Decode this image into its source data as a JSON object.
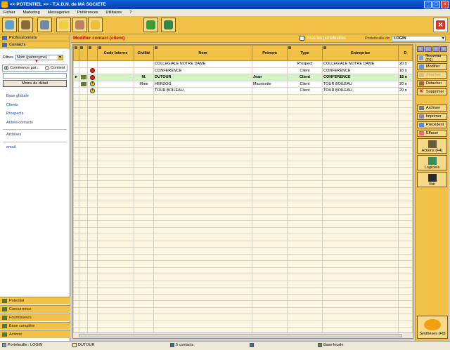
{
  "window": {
    "title": "<< POTENTIEL >> - T.A.D.N. de MA SOCIETE"
  },
  "menu": [
    "Fichier",
    "Marketing",
    "Messageries",
    "Préférences",
    "Utilitaires",
    "?"
  ],
  "left": {
    "professionnels": "Professionnels",
    "contacts": "Contacts",
    "filtres_label": "Filtres",
    "filtres_value": "Nom (patronyme)",
    "radio_commence": "Commence par...",
    "radio_contient": "Contient",
    "moins_detail": "Moins de détail",
    "links": [
      "Base globale",
      "Clients",
      "Prospects",
      "Autres contacts"
    ],
    "archives": "Archives",
    "email": "email",
    "bottom": [
      "Potentiel",
      "Concurrence",
      "Fournisseurs",
      "Base complète",
      "Actions"
    ]
  },
  "header": {
    "title": "Modifier contact (client)",
    "tous": "Tous les portefeuilles",
    "portefeuille_label": "Portefeuille de",
    "portefeuille_value": "LOGIN"
  },
  "grid": {
    "columns": [
      "Code Interne",
      "Civilité",
      "Nom",
      "Prénom",
      "Type",
      "Entreprise",
      "D"
    ],
    "rows": [
      {
        "civ": "",
        "nom": "COLLEGIALE NOTRE DAME",
        "prenom": "",
        "type": "Prospect",
        "entreprise": "COLLEGIALE NOTRE DAME",
        "d": "20 n",
        "icon": "none"
      },
      {
        "civ": "",
        "nom": "CONFERENCE",
        "prenom": "",
        "type": "Client",
        "entreprise": "CONFERENCE",
        "d": "18 n",
        "icon": "red"
      },
      {
        "civ": "M.",
        "nom": "DUTOUR",
        "prenom": "Jean",
        "type": "Client",
        "entreprise": "CONFERENCE",
        "d": "18 n",
        "icon": "red"
      },
      {
        "civ": "Mme",
        "nom": "HERZOG",
        "prenom": "Mauricette",
        "type": "Client",
        "entreprise": "TOUR BOILEAU",
        "d": "20 n",
        "icon": "yellow"
      },
      {
        "civ": "",
        "nom": "TOUR BOILEAU",
        "prenom": "",
        "type": "Client",
        "entreprise": "TOUR BOILEAU",
        "d": "20 n",
        "icon": "yellow"
      }
    ]
  },
  "right": {
    "nouveau": "Nouveau (F6)",
    "modifier": "Modifier",
    "attacher": "Attacher",
    "detacher": "Détacher",
    "supprimer": "Supprimer",
    "archiver": "Archiver",
    "imprimer": "Imprimer",
    "precedent": "Précédent",
    "effacer": "Effacer",
    "actions": "Actions (F4)",
    "logiciels": "Logiciels",
    "voir": "Voir",
    "syntheses": "Synthèses (F9)"
  },
  "status": {
    "portefeuille": "Portefeuille : LOGIN",
    "current": "DUTOUR",
    "count": "5 contacts",
    "base": "Base locale"
  },
  "colors": {
    "accent": "#f2c248",
    "title_red": "#c00000",
    "selected_row": "#d6f4c8"
  }
}
